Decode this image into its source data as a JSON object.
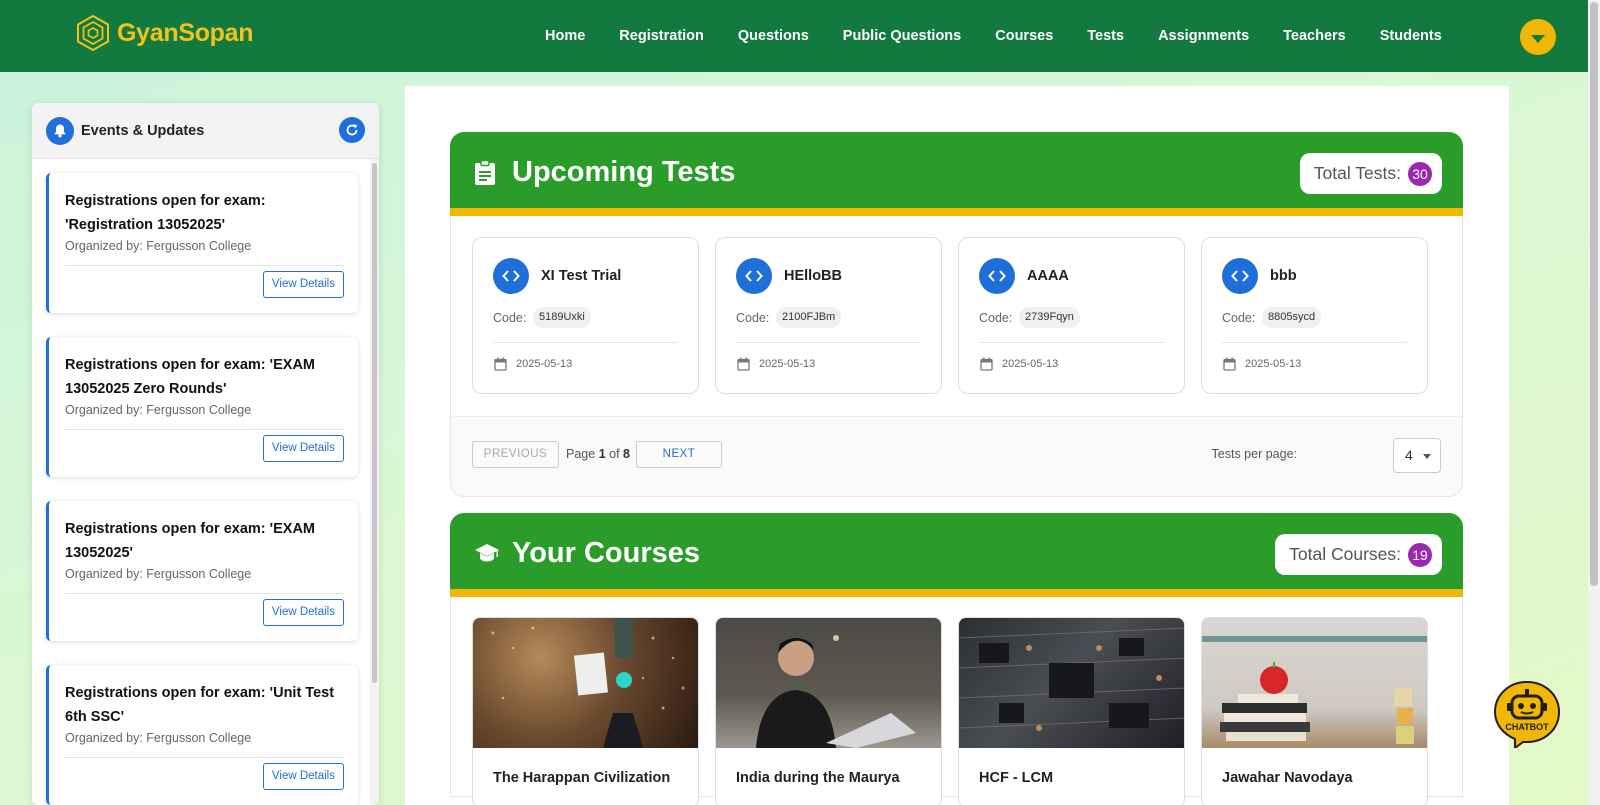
{
  "brand": {
    "name": "GyanSopan"
  },
  "nav": [
    "Home",
    "Registration",
    "Questions",
    "Public Questions",
    "Courses",
    "Tests",
    "Assignments",
    "Teachers",
    "Students"
  ],
  "sidebar": {
    "title": "Events & Updates",
    "events": [
      {
        "title": "Registrations open for exam: 'Registration 13052025'",
        "organizer": "Organized by: Fergusson College",
        "button": "View Details"
      },
      {
        "title": "Registrations open for exam: 'EXAM 13052025 Zero Rounds'",
        "organizer": "Organized by: Fergusson College",
        "button": "View Details"
      },
      {
        "title": "Registrations open for exam: 'EXAM 13052025'",
        "organizer": "Organized by: Fergusson College",
        "button": "View Details"
      },
      {
        "title": "Registrations open for exam: 'Unit Test 6th SSC'",
        "organizer": "Organized by: Fergusson College",
        "button": "View Details"
      }
    ]
  },
  "tests": {
    "title": "Upcoming Tests",
    "total_label": "Total Tests:",
    "total": "30",
    "items": [
      {
        "name": "XI Test Trial",
        "code_label": "Code:",
        "code": "5189Uxki",
        "date": "2025-05-13"
      },
      {
        "name": "HElloBB",
        "code_label": "Code:",
        "code": "2100FJBm",
        "date": "2025-05-13"
      },
      {
        "name": "AAAA",
        "code_label": "Code:",
        "code": "2739Fqyn",
        "date": "2025-05-13"
      },
      {
        "name": "bbb",
        "code_label": "Code:",
        "code": "8805sycd",
        "date": "2025-05-13"
      }
    ],
    "pager": {
      "previous": "PREVIOUS",
      "next": "NEXT",
      "page_word": "Page",
      "current": "1",
      "of_word": "of",
      "total_pages": "8",
      "per_page_label": "Tests per page:",
      "per_page": "4"
    }
  },
  "courses": {
    "title": "Your Courses",
    "total_label": "Total Courses:",
    "total": "19",
    "items": [
      {
        "name": "The Harappan Civilization"
      },
      {
        "name": "India during the Maurya"
      },
      {
        "name": "HCF - LCM"
      },
      {
        "name": "Jawahar Navodaya"
      }
    ]
  },
  "chatbot": {
    "label": "CHATBOT"
  },
  "colors": {
    "header": "#127a3f",
    "accent": "#f2b705",
    "section": "#2a9c2a",
    "primary": "#1e6fd9",
    "badge": "#9c27b0"
  }
}
